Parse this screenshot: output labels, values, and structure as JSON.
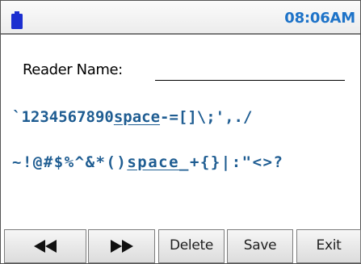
{
  "status_bar": {
    "time": "08:06AM",
    "battery_icon": "battery-icon",
    "accent_color": "#1e73c8"
  },
  "form": {
    "reader_name_label": "Reader Name:",
    "reader_name_value": ""
  },
  "keyboard": {
    "row1_left": "`1234567890",
    "row1_space": "space",
    "row1_right": "-=[]\\;',./",
    "row2_left": "~!@#$%^&*()",
    "row2_space": "space",
    "row2_right": "_+{}|:\"<>?"
  },
  "toolbar": {
    "prev_icon": "rewind-icon",
    "next_icon": "fast-forward-icon",
    "delete_label": "Delete",
    "save_label": "Save",
    "exit_label": "Exit"
  }
}
